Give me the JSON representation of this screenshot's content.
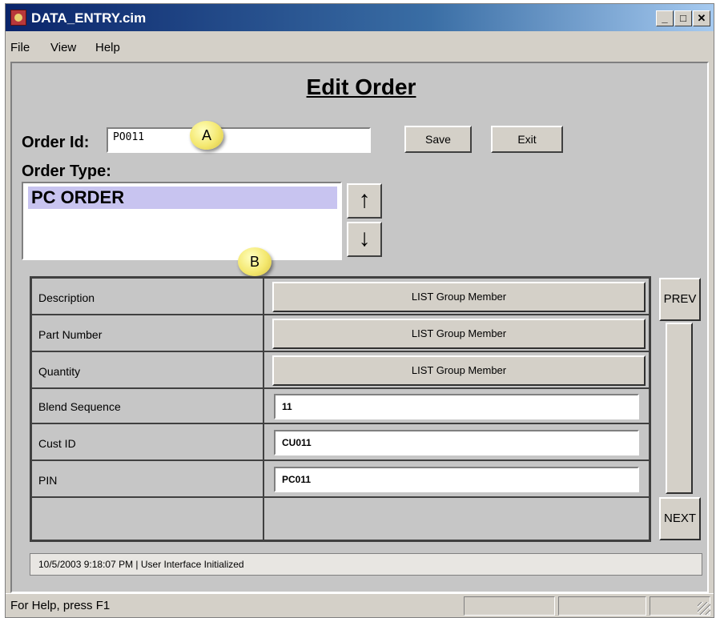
{
  "window": {
    "title": "DATA_ENTRY.cim",
    "controls": [
      "_",
      "□",
      "✕"
    ]
  },
  "menu": [
    "File",
    "View",
    "Help"
  ],
  "form": {
    "title": "Edit Order",
    "order_id_label": "Order Id:",
    "order_id_value": "PO011",
    "save_label": "Save",
    "exit_label": "Exit",
    "order_type_label": "Order Type:",
    "order_type_selected": "PC ORDER",
    "callout_a": "A",
    "callout_b": "B"
  },
  "grid": {
    "rows": [
      {
        "label": "Description",
        "kind": "button",
        "value": "LIST Group Member"
      },
      {
        "label": "Part Number",
        "kind": "button",
        "value": "LIST Group Member"
      },
      {
        "label": "Quantity",
        "kind": "button",
        "value": "LIST Group Member"
      },
      {
        "label": "Blend Sequence",
        "kind": "input",
        "value": "11"
      },
      {
        "label": "Cust ID",
        "kind": "input",
        "value": "CU011"
      },
      {
        "label": "PIN",
        "kind": "input",
        "value": "PC011"
      }
    ],
    "prev_label": "PREV",
    "next_label": "NEXT"
  },
  "status_message": "10/5/2003 9:18:07 PM |  User Interface Initialized",
  "statusbar": {
    "help_text": "For Help, press F1"
  }
}
